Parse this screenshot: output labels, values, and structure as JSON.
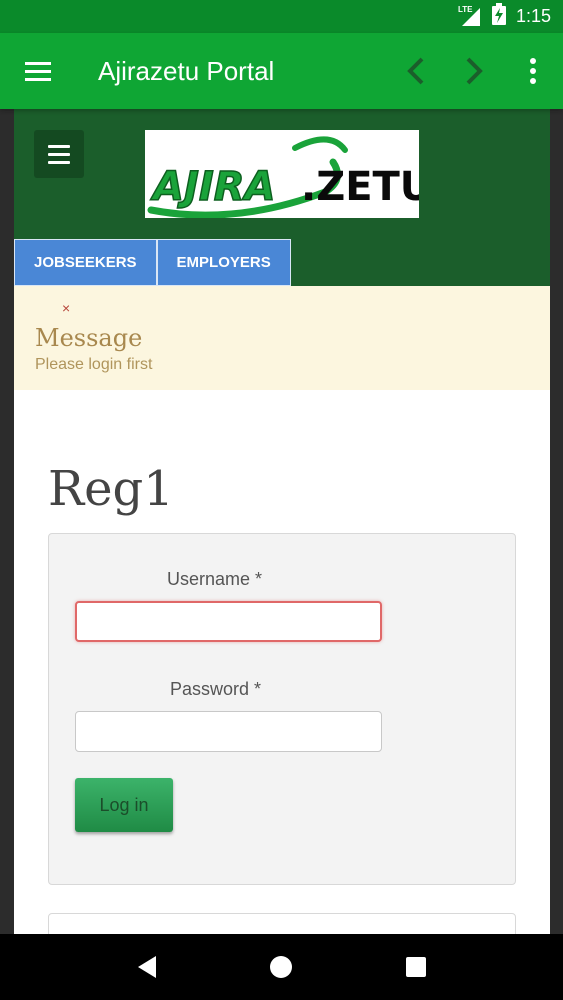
{
  "status_bar": {
    "time": "1:15",
    "network": "LTE"
  },
  "app_bar": {
    "title": "Ajirazetu Portal",
    "icons": [
      "menu-icon",
      "chevron-left-icon",
      "chevron-right-icon",
      "more-vert-icon"
    ]
  },
  "site": {
    "logo_text": "AJIRAZETU",
    "tabs": [
      {
        "label": "JOBSEEKERS"
      },
      {
        "label": "EMPLOYERS"
      }
    ]
  },
  "message": {
    "close": "×",
    "title": "Message",
    "text": "Please login first"
  },
  "page": {
    "heading": "Reg1",
    "username_label": "Username *",
    "username_value": "",
    "password_label": "Password *",
    "password_value": "",
    "login_label": "Log in"
  },
  "colors": {
    "status_bar": "#0a8a2a",
    "app_bar": "#0fa634",
    "site_header": "#1b5e2b",
    "tab": "#4a87d6",
    "message_bg": "#fcf6df",
    "login_button": "#2a9d54"
  }
}
